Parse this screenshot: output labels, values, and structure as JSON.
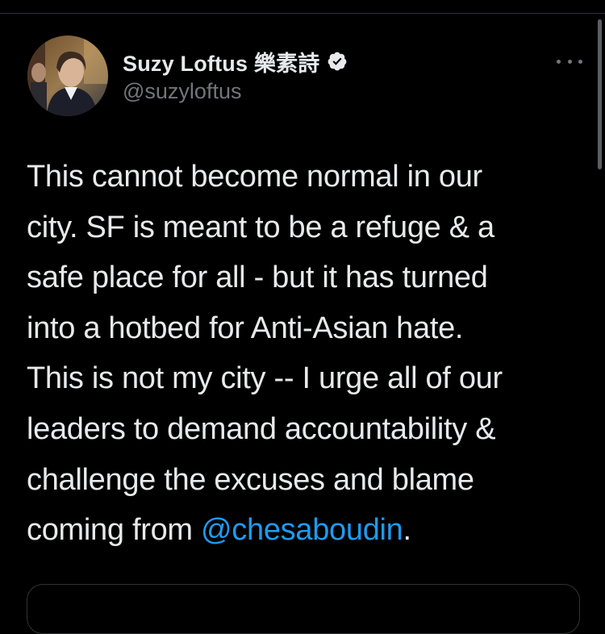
{
  "tweet": {
    "author": {
      "display_name": "Suzy Loftus 樂素詩",
      "handle": "@suzyloftus",
      "verified": true
    },
    "text_lines": [
      "This cannot become normal in our",
      "city. SF is meant to be a refuge & a",
      "safe place for all - but it has turned",
      "into a hotbed for Anti-Asian hate.",
      "This is not my city -- I urge all of our",
      "leaders to demand accountability &",
      "challenge the excuses and blame",
      "coming from "
    ],
    "mention": "@chesaboudin",
    "trailing_text": "."
  },
  "icons": {
    "verified": "verified-badge-icon",
    "more": "more-options-icon"
  },
  "colors": {
    "background": "#000000",
    "primary_text": "#e7e9ea",
    "secondary_text": "#71767b",
    "link": "#1d9bf0",
    "divider": "#2f3336"
  }
}
